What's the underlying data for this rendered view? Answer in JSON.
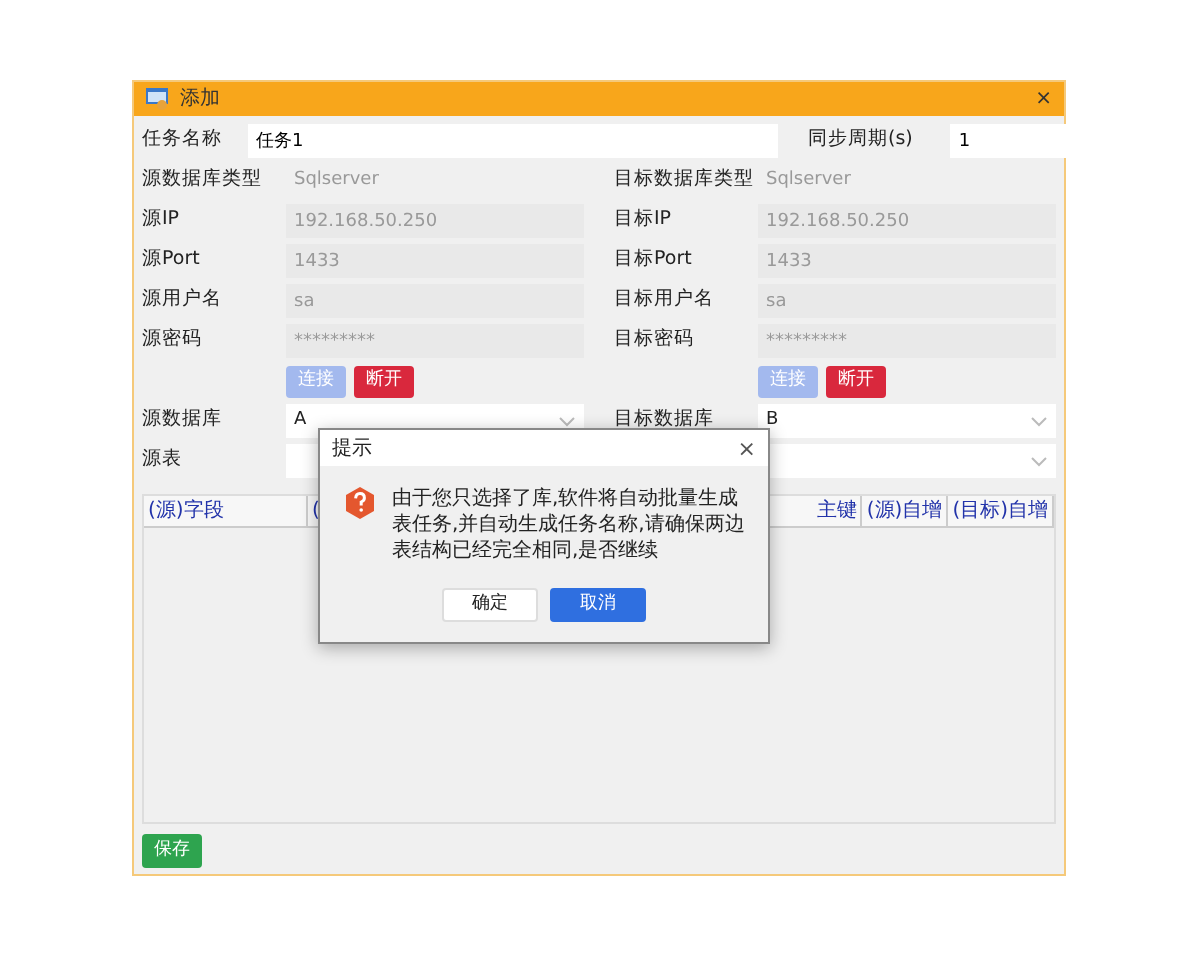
{
  "window": {
    "title": "添加",
    "close": "×"
  },
  "task": {
    "name_label": "任务名称",
    "name_value": "任务1",
    "period_label": "同步周期(s)",
    "period_value": "1"
  },
  "rows": [
    {
      "left": {
        "label": "源数据库类型",
        "value": "Sqlserver",
        "kind": "text"
      },
      "right": {
        "label": "目标数据库类型",
        "value": "Sqlserver",
        "kind": "text"
      }
    },
    {
      "left": {
        "label": "源IP",
        "value": "192.168.50.250",
        "kind": "input",
        "disabled": true
      },
      "right": {
        "label": "目标IP",
        "value": "192.168.50.250",
        "kind": "input",
        "disabled": true
      }
    },
    {
      "left": {
        "label": "源Port",
        "value": "1433",
        "kind": "input",
        "disabled": true
      },
      "right": {
        "label": "目标Port",
        "value": "1433",
        "kind": "input",
        "disabled": true
      }
    },
    {
      "left": {
        "label": "源用户名",
        "value": "sa",
        "kind": "input",
        "disabled": true
      },
      "right": {
        "label": "目标用户名",
        "value": "sa",
        "kind": "input",
        "disabled": true
      }
    },
    {
      "left": {
        "label": "源密码",
        "value": "*********",
        "kind": "input",
        "disabled": true
      },
      "right": {
        "label": "目标密码",
        "value": "*********",
        "kind": "input",
        "disabled": true
      }
    },
    {
      "left": {
        "kind": "buttons",
        "buttons": [
          {
            "label": "连接",
            "kind": "connect",
            "disabled": true
          },
          {
            "label": "断开",
            "kind": "disconnect",
            "disabled": false
          }
        ]
      },
      "right": {
        "kind": "buttons",
        "buttons": [
          {
            "label": "连接",
            "kind": "connect",
            "disabled": true
          },
          {
            "label": "断开",
            "kind": "disconnect",
            "disabled": false
          }
        ]
      }
    },
    {
      "left": {
        "label": "源数据库",
        "value": "A",
        "kind": "select"
      },
      "right": {
        "label": "目标数据库",
        "value": "B",
        "kind": "select"
      }
    },
    {
      "left": {
        "label": "源表",
        "kind": "select"
      },
      "right": {
        "kind": "select"
      }
    }
  ],
  "table": {
    "columns_left": [
      "(源)字段",
      "("
    ],
    "columns_right": [
      "主键",
      "(源)自增",
      "(目标)自增"
    ]
  },
  "save_button": "保存",
  "dialog": {
    "title": "提示",
    "close": "×",
    "message": "由于您只选择了库,软件将自动批量生成表任务,并自动生成任务名称,请确保两边表结构已经完全相同,是否继续",
    "buttons": [
      {
        "label": "确定",
        "kind": "secondary"
      },
      {
        "label": "取消",
        "kind": "primary"
      }
    ]
  }
}
